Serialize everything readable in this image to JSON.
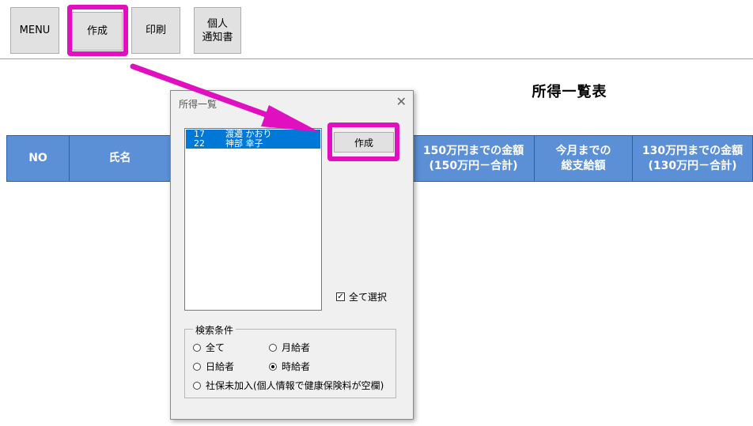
{
  "toolbar": {
    "menu_label": "MENU",
    "create_label": "作成",
    "print_label": "印刷",
    "notice_label": "個人\n通知書"
  },
  "page": {
    "title": "所得一覧表"
  },
  "table_headers": [
    "NO",
    "氏名",
    "150万円までの金額\n(150万円－合計)",
    "今月までの\n総支給額",
    "130万円までの金額\n(130万円－合計)"
  ],
  "dialog": {
    "title": "所得一覧",
    "close_glyph": "✕",
    "list": [
      {
        "num": "17",
        "name": "渡邉 かおり"
      },
      {
        "num": "22",
        "name": "神部 幸子"
      }
    ],
    "create_label": "作成",
    "select_all_label": "全て選択",
    "select_all_checked": true,
    "search_legend": "検索条件",
    "radios": {
      "all": "全て",
      "monthly": "月給者",
      "daily": "日給者",
      "hourly": "時給者",
      "uninsured": "社保未加入(個人情報で健康保険料が空欄)"
    },
    "selected_radio": "hourly"
  },
  "colors": {
    "highlight": "#e010c0",
    "header_bg": "#5b8fd6",
    "selection": "#0078d7"
  }
}
